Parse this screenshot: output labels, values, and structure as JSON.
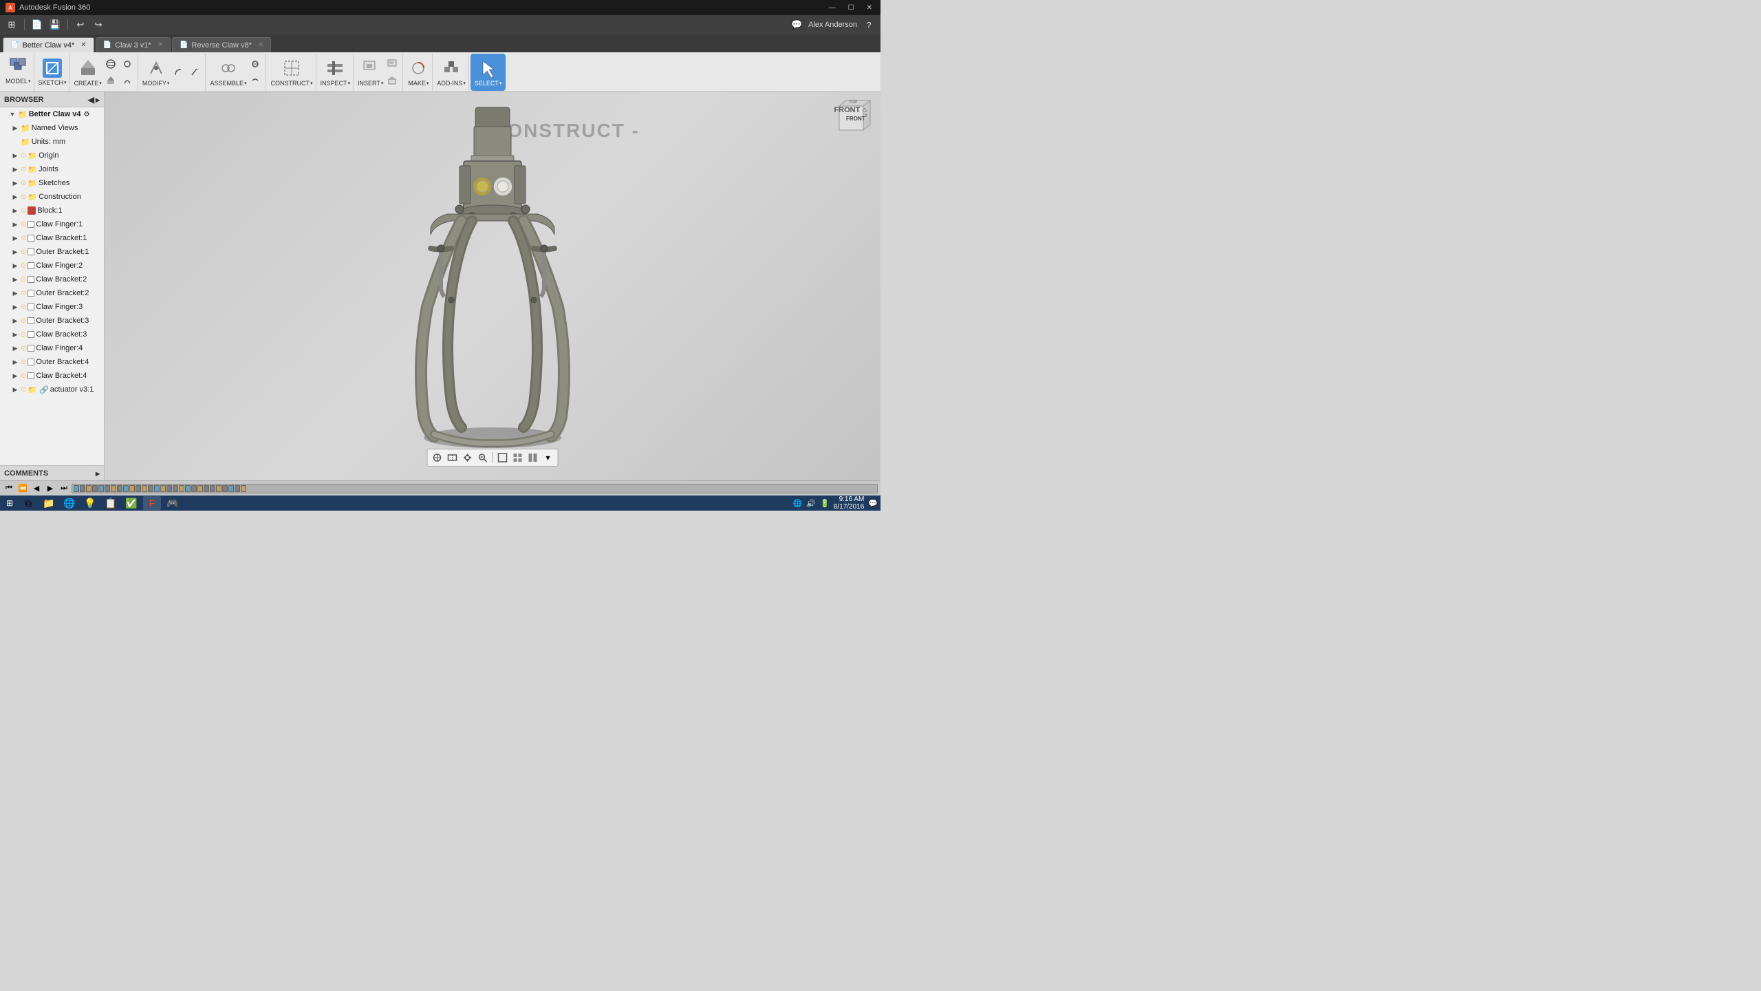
{
  "app": {
    "name": "Autodesk Fusion 360",
    "logo_text": "A"
  },
  "titlebar": {
    "title": "Autodesk Fusion 360",
    "minimize": "—",
    "maximize": "☐",
    "close": "✕"
  },
  "quick_access": {
    "grid_icon": "⊞",
    "new_icon": "📄",
    "save_icon": "💾",
    "undo_icon": "↩",
    "redo_icon": "↪",
    "user": "Alex Anderson",
    "help_icon": "?",
    "chat_icon": "💬"
  },
  "tabs": [
    {
      "label": "Better Claw v4*",
      "active": true
    },
    {
      "label": "Claw 3 v1*",
      "active": false
    },
    {
      "label": "Reverse Claw v8*",
      "active": false
    }
  ],
  "toolbar": {
    "groups": [
      {
        "id": "model",
        "icon": "⬜",
        "label": "MODEL",
        "has_arrow": true
      },
      {
        "id": "sketch",
        "icon": "✏️",
        "label": "SKETCH",
        "has_arrow": true
      },
      {
        "id": "create",
        "icon": "⬛",
        "label": "CREATE",
        "has_arrow": true
      },
      {
        "id": "modify",
        "icon": "🔧",
        "label": "MODIFY",
        "has_arrow": true
      },
      {
        "id": "assemble",
        "icon": "🔩",
        "label": "ASSEMBLE",
        "has_arrow": true
      },
      {
        "id": "construct",
        "icon": "📐",
        "label": "CONSTRUCT",
        "has_arrow": true
      },
      {
        "id": "inspect",
        "icon": "🔍",
        "label": "INSPECT",
        "has_arrow": true
      },
      {
        "id": "insert",
        "icon": "📸",
        "label": "INSERT",
        "has_arrow": true
      },
      {
        "id": "make",
        "icon": "⚙️",
        "label": "MAKE",
        "has_arrow": true
      },
      {
        "id": "add-ins",
        "icon": "🔌",
        "label": "ADD-INS",
        "has_arrow": true
      },
      {
        "id": "select",
        "icon": "↖️",
        "label": "SELECT",
        "has_arrow": true,
        "active": true
      }
    ]
  },
  "browser": {
    "title": "BROWSER",
    "root": "Better Claw v4",
    "items": [
      {
        "id": "named-views",
        "label": "Named Views",
        "depth": 1,
        "type": "folder",
        "expanded": false
      },
      {
        "id": "units",
        "label": "Units: mm",
        "depth": 1,
        "type": "folder-gray",
        "expanded": false
      },
      {
        "id": "origin",
        "label": "Origin",
        "depth": 1,
        "type": "folder",
        "has_eye": true,
        "expanded": false
      },
      {
        "id": "joints",
        "label": "Joints",
        "depth": 1,
        "type": "folder",
        "has_eye": true,
        "expanded": false
      },
      {
        "id": "sketches",
        "label": "Sketches",
        "depth": 1,
        "type": "folder",
        "has_eye": true,
        "expanded": false
      },
      {
        "id": "construction",
        "label": "Construction",
        "depth": 1,
        "type": "folder",
        "has_eye": true,
        "expanded": false
      },
      {
        "id": "block1",
        "label": "Block:1",
        "depth": 1,
        "type": "colored",
        "color": "#c04040",
        "has_eye": true,
        "expanded": false
      },
      {
        "id": "claw-finger-1",
        "label": "Claw Finger:1",
        "depth": 1,
        "type": "box",
        "has_eye": true,
        "expanded": false
      },
      {
        "id": "claw-bracket-1",
        "label": "Claw Bracket:1",
        "depth": 1,
        "type": "box",
        "has_eye": true,
        "expanded": false
      },
      {
        "id": "outer-bracket-1",
        "label": "Outer Bracket:1",
        "depth": 1,
        "type": "box",
        "has_eye": true,
        "expanded": false
      },
      {
        "id": "claw-finger-2",
        "label": "Claw Finger:2",
        "depth": 1,
        "type": "box",
        "has_eye": true,
        "expanded": false
      },
      {
        "id": "claw-bracket-2",
        "label": "Claw Bracket:2",
        "depth": 1,
        "type": "box",
        "has_eye": true,
        "expanded": false
      },
      {
        "id": "outer-bracket-2",
        "label": "Outer Bracket:2",
        "depth": 1,
        "type": "box",
        "has_eye": true,
        "expanded": false
      },
      {
        "id": "claw-finger-3",
        "label": "Claw Finger:3",
        "depth": 1,
        "type": "box",
        "has_eye": true,
        "expanded": false
      },
      {
        "id": "outer-bracket-3",
        "label": "Outer Bracket:3",
        "depth": 1,
        "type": "box",
        "has_eye": true,
        "expanded": false
      },
      {
        "id": "claw-bracket-3",
        "label": "Claw Bracket:3",
        "depth": 1,
        "type": "box",
        "has_eye": true,
        "expanded": false
      },
      {
        "id": "claw-finger-4",
        "label": "Claw Finger:4",
        "depth": 1,
        "type": "box",
        "has_eye": true,
        "expanded": false
      },
      {
        "id": "outer-bracket-4",
        "label": "Outer Bracket:4",
        "depth": 1,
        "type": "box",
        "has_eye": true,
        "expanded": false
      },
      {
        "id": "claw-bracket-4",
        "label": "Claw Bracket:4",
        "depth": 1,
        "type": "box",
        "has_eye": true,
        "expanded": false
      },
      {
        "id": "actuator",
        "label": "actuator v3:1",
        "depth": 1,
        "type": "link",
        "has_eye": true,
        "expanded": false
      }
    ]
  },
  "comments": {
    "label": "COMMENTS"
  },
  "viewport": {
    "construct_label": "CONSTRUCT -",
    "front_label": "FRONT ⌂"
  },
  "bottom_toolbar": {
    "buttons": [
      "⊕",
      "⊟",
      "⊞",
      "↺",
      "⊕",
      "⊘",
      "⊞",
      "⊟",
      "⊠"
    ]
  },
  "timeline": {
    "play_first": "⏮",
    "play_prev": "⏪",
    "play_rev": "◀",
    "play": "▶",
    "play_last": "⏭"
  },
  "taskbar": {
    "start_icon": "⊞",
    "apps": [
      "🗂️",
      "📁",
      "🌐",
      "💡",
      "📋",
      "✅",
      "📦",
      "🎮"
    ],
    "time": "9:16 AM",
    "date": "8/17/2016"
  }
}
